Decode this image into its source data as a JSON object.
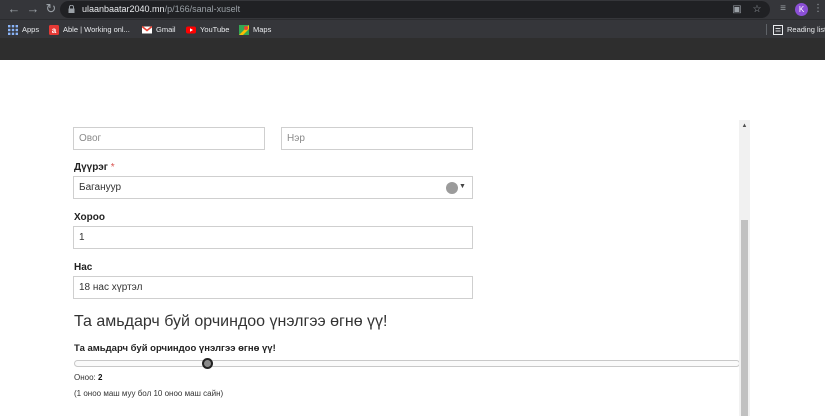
{
  "browser": {
    "url_host": "ulaanbaatar2040.mn",
    "url_path": "/p/166/sanal-xuselt",
    "profile_initial": "K"
  },
  "bookmarks": {
    "items": [
      {
        "label": "Apps",
        "icon": "apps-grid-icon"
      },
      {
        "label": "Able  |  Working onl...",
        "icon": "able-icon"
      },
      {
        "label": "Gmail",
        "icon": "gmail-icon"
      },
      {
        "label": "YouTube",
        "icon": "youtube-icon"
      },
      {
        "label": "Maps",
        "icon": "maps-icon"
      }
    ],
    "reading_list": "Reading list"
  },
  "form": {
    "lastname_placeholder": "Овог",
    "firstname_placeholder": "Нэр",
    "district": {
      "label": "Дүүрэг",
      "required_mark": "*",
      "value": "Багануур"
    },
    "khoroo": {
      "label": "Хороо",
      "value": "1"
    },
    "age": {
      "label": "Нас",
      "value": "18 нас хүртэл"
    }
  },
  "rating": {
    "section_title": "Та амьдарч буй орчиндоо үнэлгээ өгнө үү!",
    "question": "Та амьдарч буй орчиндоо үнэлгээ өгнө үү!",
    "score_label": "Оноо:",
    "score_value": "2",
    "score_fraction": 0.2,
    "scale_note": "(1 оноо маш муу бол 10 оноо маш сайн)"
  },
  "colors": {
    "chrome_bg": "#35363a",
    "url_bg": "#202124",
    "header_band": "#2e2e2e",
    "required": "#d9534f",
    "avatar": "#8b4fd6"
  }
}
